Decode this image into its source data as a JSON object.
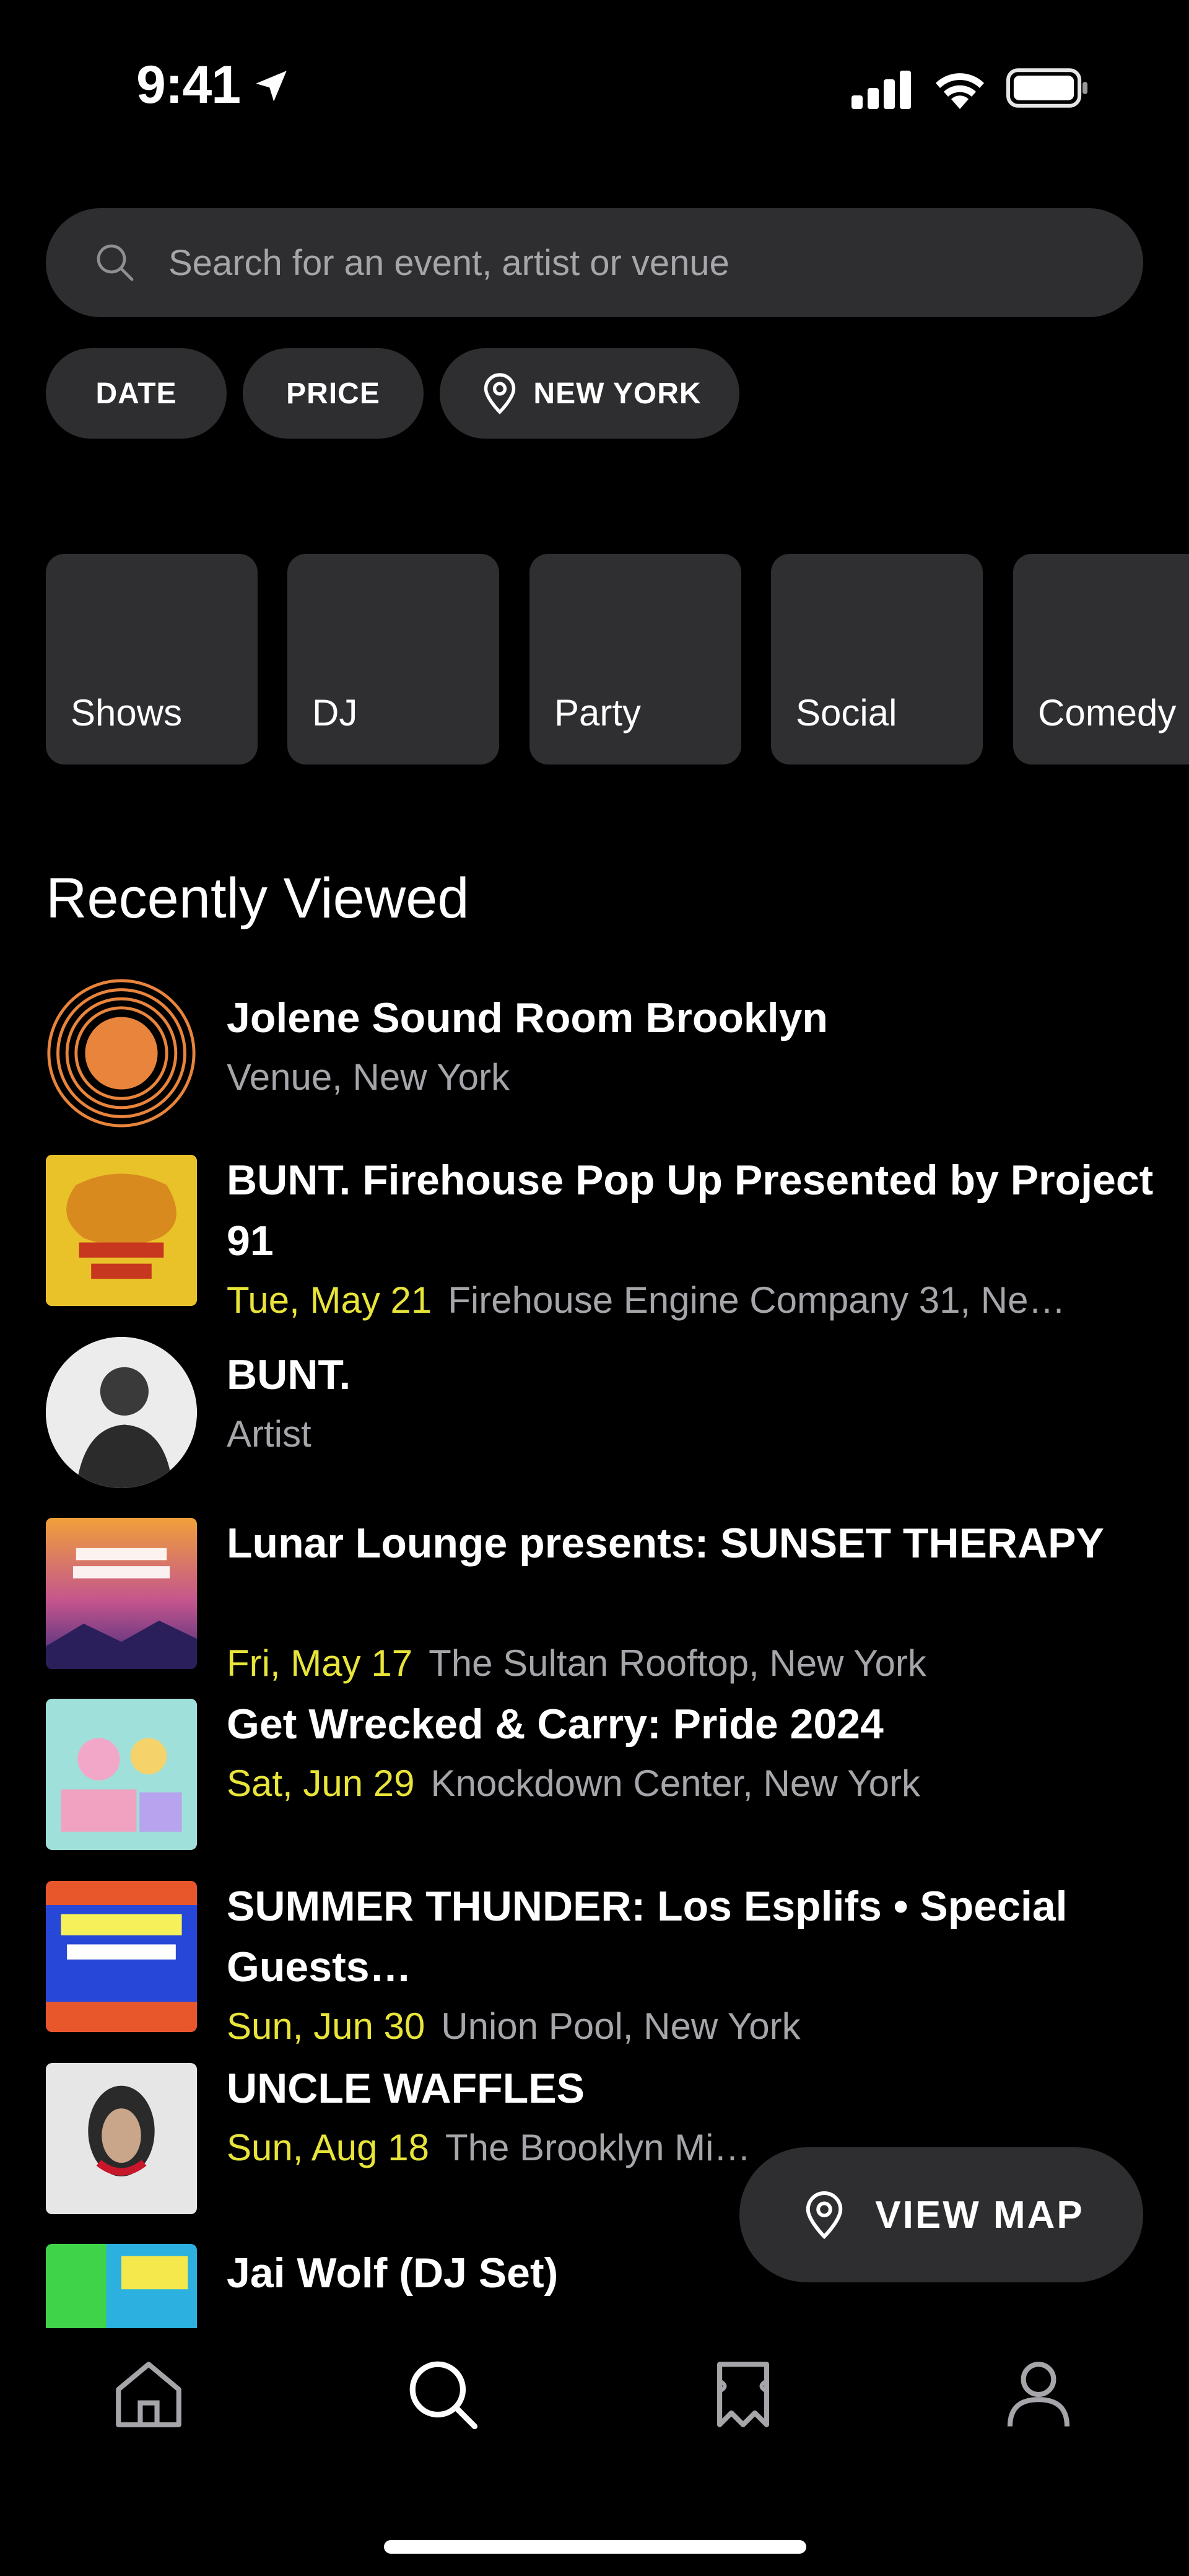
{
  "status_bar": {
    "time": "9:41"
  },
  "search": {
    "placeholder": "Search for an event, artist or venue"
  },
  "filters": {
    "date": "DATE",
    "price": "PRICE",
    "location": "NEW YORK"
  },
  "categories": [
    "Shows",
    "DJ",
    "Party",
    "Social",
    "Comedy"
  ],
  "section_title": "Recently Viewed",
  "recent": [
    {
      "title": "Jolene Sound Room Brooklyn",
      "date": "",
      "subtitle": "Venue, New York",
      "thumb": "venue-logo"
    },
    {
      "title": "BUNT. Firehouse Pop Up Presented by Project 91",
      "date": "Tue, May 21",
      "subtitle": "Firehouse Engine Company 31, Ne…",
      "thumb": "poster-yellow"
    },
    {
      "title": "BUNT.",
      "date": "",
      "subtitle": "Artist",
      "thumb": "artist-photo"
    },
    {
      "title": "Lunar Lounge presents: SUNSET THERAPY",
      "date": "Fri, May 17",
      "subtitle": "The Sultan Rooftop, New York",
      "thumb": "poster-sunset"
    },
    {
      "title": "Get Wrecked & Carry: Pride 2024",
      "date": "Sat, Jun 29",
      "subtitle": "Knockdown Center, New York",
      "thumb": "poster-pride"
    },
    {
      "title": "SUMMER THUNDER: Los Esplifs • Special Guests…",
      "date": "Sun, Jun 30",
      "subtitle": "Union Pool, New York",
      "thumb": "poster-union"
    },
    {
      "title": "UNCLE WAFFLES",
      "date": "Sun, Aug 18",
      "subtitle": "The Brooklyn Mi…",
      "thumb": "poster-waffles"
    },
    {
      "title": "Jai Wolf (DJ Set)",
      "date": "",
      "subtitle": "",
      "thumb": "poster-jai"
    }
  ],
  "view_map": {
    "label": "VIEW MAP"
  },
  "colors": {
    "background": "#000000",
    "surface": "#2e2e30",
    "date_accent": "#e8e43a",
    "muted_text": "#a5a5aa"
  },
  "tabs": [
    "home-icon",
    "search-icon",
    "tickets-icon",
    "profile-icon"
  ]
}
